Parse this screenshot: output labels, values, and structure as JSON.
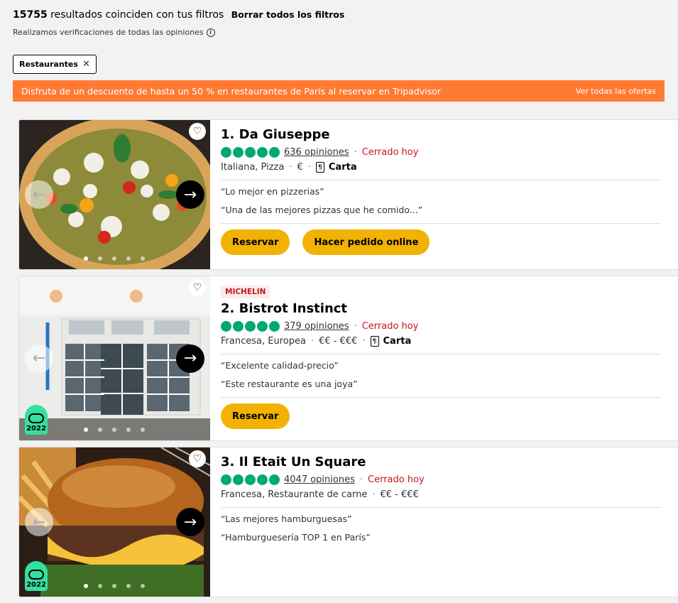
{
  "summary": {
    "count": "15755",
    "text": "resultados coinciden con tus filtros",
    "clear": "Borrar todos los filtros"
  },
  "verification": {
    "text": "Realizamos verificaciones de todas las opiniones",
    "icon": "info-icon"
  },
  "filters": [
    {
      "label": "Restaurantes"
    }
  ],
  "banner": {
    "text": "Disfruta de un descuento de hasta un 50 % en restaurantes de París al reservar en Tripadvisor",
    "link": "Ver todas las ofertas",
    "color": "#ff7a33"
  },
  "restaurants": [
    {
      "title": "1. Da Giuseppe",
      "rating": 5,
      "reviews": "636 opiniones",
      "status": "Cerrado hoy",
      "cuisine": "Italiana, Pizza",
      "price": "€",
      "menu": "Carta",
      "quotes": [
        "“Lo mejor en pizzerias”",
        "“Una de las mejores pizzas que he comido...”"
      ],
      "buttons": [
        "Reservar",
        "Hacer pedido online"
      ]
    },
    {
      "badge": "MICHELIN",
      "title": "2. Bistrot Instinct",
      "rating": 5,
      "reviews": "379 opiniones",
      "status": "Cerrado hoy",
      "cuisine": "Francesa, Europea",
      "price": "€€ - €€€",
      "menu": "Carta",
      "quotes": [
        "“Excelente calidad-precio”",
        "“Este restaurante es una joya”"
      ],
      "buttons": [
        "Reservar"
      ],
      "award": "2022"
    },
    {
      "title": "3. Il Etait Un Square",
      "rating": 5,
      "reviews": "4047 opiniones",
      "status": "Cerrado hoy",
      "cuisine": "Francesa, Restaurante de carne",
      "price": "€€ - €€€",
      "quotes": [
        "“Las mejores hamburguesas”",
        "“Hamburguesería TOP 1 en París”"
      ],
      "award": "2022"
    }
  ],
  "colors": {
    "bubble": "#00aa6c",
    "closed": "#c4161c",
    "button": "#f2b203",
    "award": "#34e0a1"
  }
}
